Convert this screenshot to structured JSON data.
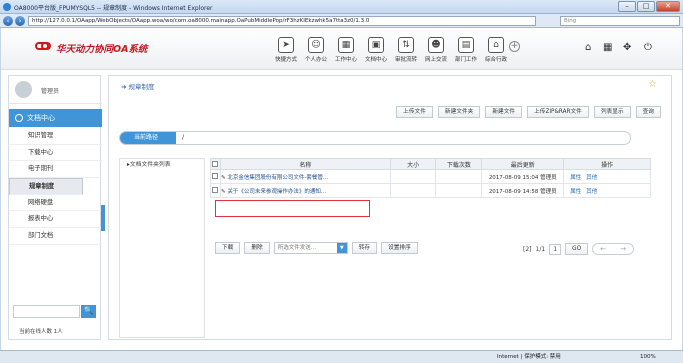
{
  "window": {
    "title": "OA8000平台版_FPUMYSQL5 -- 规章制度 - Windows Internet Explorer",
    "url": "http://127.0.0.1/OAapp/WebObjects/OAapp.woa/wo/com.oa8000.mainapp.OaPubMiddlePop/rF3hzKIEkzwhk5a7tta3z0/1.3.0",
    "search_placeholder": "Bing",
    "controls": {
      "minimize": "–",
      "maximize": "□",
      "close": "✕"
    }
  },
  "app": {
    "title": "华天动力协同OA系统"
  },
  "modules": [
    {
      "icon": "➤",
      "label": "快捷方式"
    },
    {
      "icon": "☺",
      "label": "个人办公"
    },
    {
      "icon": "▦",
      "label": "工作中心"
    },
    {
      "icon": "▣",
      "label": "文档中心"
    },
    {
      "icon": "⇅",
      "label": "审批流转"
    },
    {
      "icon": "☻",
      "label": "网上交流"
    },
    {
      "icon": "▤",
      "label": "部门工作"
    },
    {
      "icon": "⌂",
      "label": "综合行政"
    }
  ],
  "header_icons": {
    "add": "+",
    "home": "⌂",
    "grid": "▦",
    "shirt": "✥",
    "power": "⏻"
  },
  "sidebar": {
    "username": "管理员",
    "section": "文档中心",
    "items": [
      "知识管理",
      "下载中心",
      "电子期刊",
      "规章制度",
      "网络硬盘",
      "报表中心",
      "部门文档"
    ],
    "selected_index": 3,
    "search_button": "🔍",
    "online_text": "当前在线人数 1人"
  },
  "main": {
    "breadcrumb": "规章制度",
    "star": "☆",
    "toolbar": [
      "上传文件",
      "新建文件夹",
      "新建文件",
      "上传ZIP&RAR文件",
      "列表显示",
      "查询"
    ],
    "path_label": "当前路径",
    "path_value": "/",
    "tree_label": "文档文件夹列表",
    "table": {
      "headers": [
        "",
        "名称",
        "大小",
        "下载次数",
        "最后更新",
        "操作"
      ],
      "rows": [
        {
          "name": "北京金信集团股份有限公司文件-套餐管...",
          "size": "",
          "downloads": "",
          "updated": "2017-08-09 15:04",
          "owner": "管理员",
          "actions": [
            "属性",
            "其他"
          ]
        },
        {
          "name": "关于《公司未来参观操作办法》的通知...",
          "size": "",
          "downloads": "",
          "updated": "2017-08-09 14:58",
          "owner": "管理员",
          "actions": [
            "属性",
            "其他"
          ]
        }
      ]
    },
    "bottom": {
      "download": "下载",
      "delete": "删除",
      "select_placeholder": "所选文件发送...",
      "select_arrow": "▼",
      "move": "转存",
      "settings": "设置排序",
      "total": "[2]",
      "page": "1/1",
      "page_input": "1",
      "go": "GO",
      "prev": "←",
      "next": "→"
    }
  },
  "statusbar": {
    "zone": "Internet | 保护模式: 禁用",
    "zoom": "100%"
  }
}
